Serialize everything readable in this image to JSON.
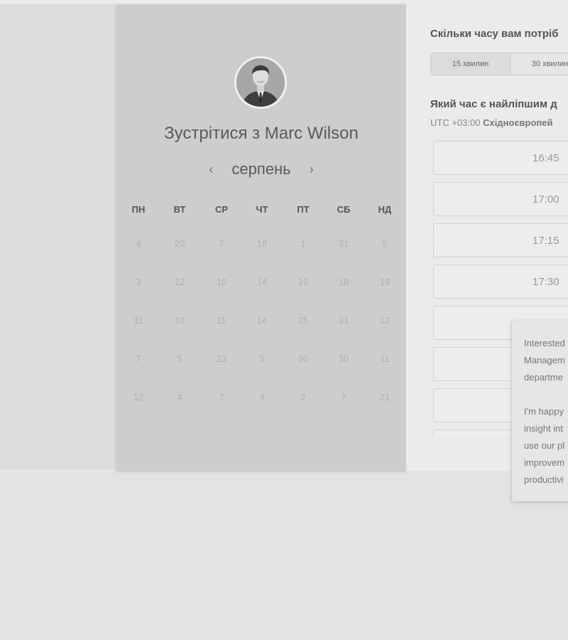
{
  "calendar": {
    "title": "Зустрітися з Marc Wilson",
    "month": "серпень",
    "prev_arrow": "‹",
    "next_arrow": "›",
    "weekdays": [
      "ПН",
      "ВТ",
      "СР",
      "ЧТ",
      "ПТ",
      "СБ",
      "НД"
    ],
    "weeks": [
      [
        "4",
        "20",
        "7",
        "18",
        "1",
        "31",
        "5"
      ],
      [
        "3",
        "12",
        "10",
        "14",
        "16",
        "18",
        "19"
      ],
      [
        "11",
        "10",
        "11",
        "14",
        "25",
        "31",
        "12"
      ],
      [
        "7",
        "5",
        "23",
        "5",
        "30",
        "30",
        "11"
      ],
      [
        "12",
        "4",
        "7",
        "4",
        "2",
        "7",
        "21"
      ]
    ]
  },
  "scheduler": {
    "duration_question": "Скільки часу вам потріб",
    "durations": [
      "15 хвилин",
      "30 хвилин"
    ],
    "selected_duration": "15 хвилин",
    "time_question": "Який час є найліпшим д",
    "timezone_offset": "UTC +03:00",
    "timezone_name": "Східноєвропей",
    "slots": [
      "16:45",
      "17:00",
      "17:15",
      "17:30",
      "",
      "",
      "",
      ""
    ]
  },
  "popup": {
    "paragraphs": [
      [
        "Interested",
        "Managem",
        "departme"
      ],
      [
        "I'm happy",
        "insight int",
        "use our pl",
        "improvem",
        "productivi"
      ]
    ]
  },
  "icons": {
    "avatar": "profile-photo",
    "prev": "chevron-left-icon",
    "next": "chevron-right-icon"
  }
}
